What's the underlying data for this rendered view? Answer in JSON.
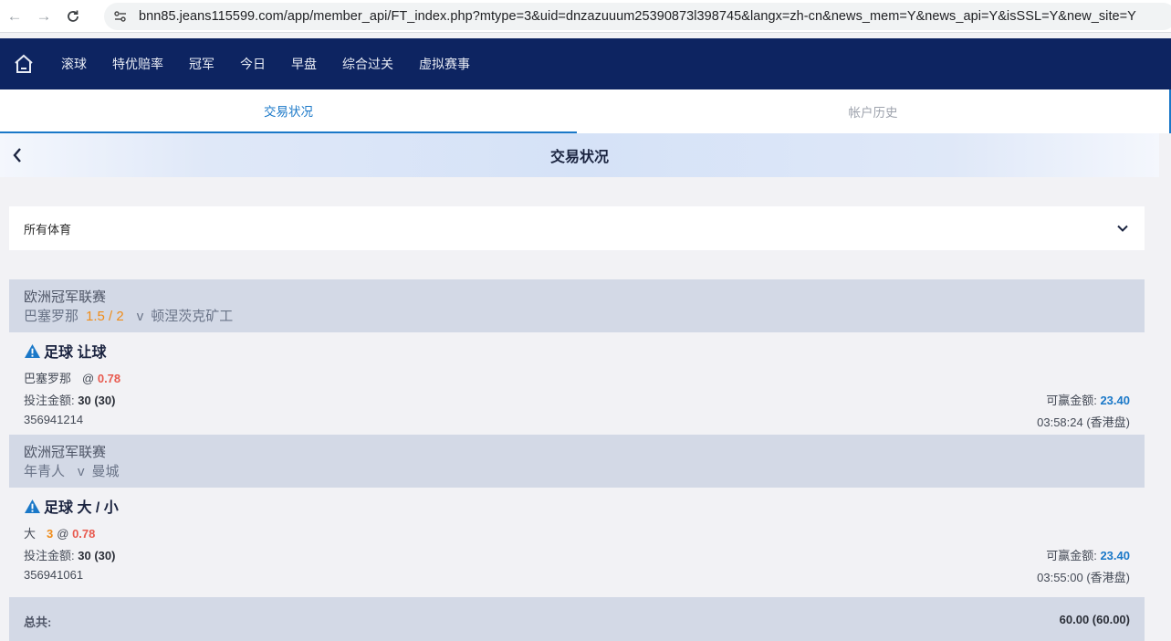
{
  "browser": {
    "url": "bnn85.jeans115599.com/app/member_api/FT_index.php?mtype=3&uid=dnzazuuum25390873l398745&langx=zh-cn&news_mem=Y&news_api=Y&isSSL=Y&new_site=Y"
  },
  "topnav": {
    "items": [
      "滚球",
      "特优赔率",
      "冠军",
      "今日",
      "早盘",
      "综合过关",
      "虚拟赛事"
    ]
  },
  "tabs": [
    "交易状况",
    "帐户历史"
  ],
  "banner": {
    "title": "交易状况"
  },
  "sport_select": {
    "value": "所有体育"
  },
  "bets": [
    {
      "league": "欧洲冠军联赛",
      "home": "巴塞罗那",
      "handicap": "1.5 / 2",
      "vs": "v",
      "away": "顿涅茨克矿工",
      "bet_type": "足球 让球",
      "selection": "巴塞罗那",
      "line": "",
      "at": "@",
      "odds": "0.78",
      "stake_label": "投注金额:",
      "stake": "30 (30)",
      "win_label": "可赢金额:",
      "win": "23.40",
      "ticket_id": "356941214",
      "time": "03:58:24 (香港盘)"
    },
    {
      "league": "欧洲冠军联赛",
      "home": "年青人",
      "handicap": "",
      "vs": "v",
      "away": "曼城",
      "bet_type": "足球 大 / 小",
      "selection": "大",
      "line": "3",
      "at": "@",
      "odds": "0.78",
      "stake_label": "投注金额:",
      "stake": "30 (30)",
      "win_label": "可赢金额:",
      "win": "23.40",
      "ticket_id": "356941061",
      "time": "03:55:00 (香港盘)"
    }
  ],
  "total": {
    "label": "总共:",
    "value": "60.00 (60.00)"
  },
  "colors": {
    "nav_bg": "#0d2461",
    "accent": "#1a78c8",
    "odds": "#e85a4f",
    "handicap": "#f08c18"
  }
}
